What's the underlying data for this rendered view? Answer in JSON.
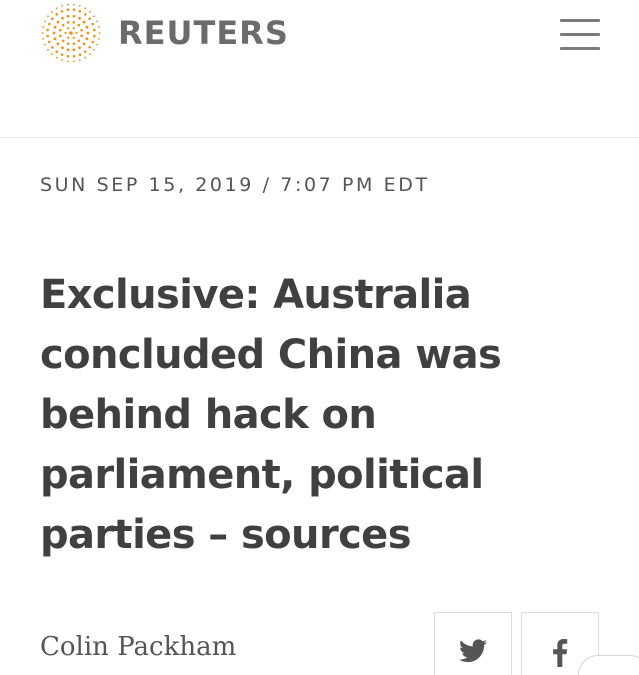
{
  "header": {
    "brand": "REUTERS",
    "colors": {
      "logo_orange": "#f29019",
      "brand_text": "#6b6b6b"
    },
    "logo_icon": "reuters-dot-ring-logo",
    "menu_icon": "hamburger-menu-icon"
  },
  "article": {
    "timestamp": "SUN SEP 15, 2019 / 7:07 PM EDT",
    "headline": "Exclusive: Australia concluded China was behind hack on parliament, political parties – sources",
    "byline": "Colin Packham"
  },
  "share": {
    "buttons": [
      {
        "icon": "twitter-bird-icon",
        "color": "#555555"
      },
      {
        "icon": "facebook-f-icon",
        "color": "#555555"
      }
    ]
  }
}
